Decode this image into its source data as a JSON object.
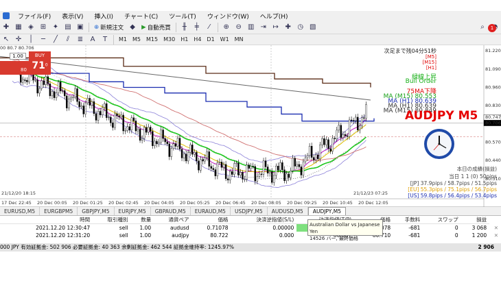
{
  "menu": {
    "items": [
      "ファイル(F)",
      "表示(V)",
      "挿入(I)",
      "チャート(C)",
      "ツール(T)",
      "ウィンドウ(W)",
      "ヘルプ(H)"
    ]
  },
  "toolbar": {
    "new_order": "新規注文",
    "auto_trading": "自動売買",
    "notifications": "1",
    "timeframes": [
      "M1",
      "M5",
      "M15",
      "M30",
      "H1",
      "H4",
      "D1",
      "W1",
      "MN"
    ]
  },
  "chart": {
    "header_text": "00 80.7 80.706",
    "oneclick": {
      "lot": "1.00",
      "buy_label": "BUY",
      "sell_prefix": "80",
      "sell_big": "71",
      "sell_sup": "0"
    },
    "countdown": "次足まで残04分51秒",
    "tf_m5": "[M5]",
    "tf_m15": "[M15]",
    "tf_h1": "[H1]",
    "trend_up": "緑線上昇",
    "bull_order": "Bull Order",
    "ma_down": "75MA下降",
    "ma_lines": [
      {
        "text": "MA (M15) 80.553",
        "color": "#19a019"
      },
      {
        "text": "MA (H1) 80.639",
        "color": "#1a2db0"
      },
      {
        "text": "MA (H1) 80.639",
        "color": "#333333"
      },
      {
        "text": "MA (M15) 80.849",
        "color": "#333333"
      }
    ],
    "symbol": "AUDJPY M5",
    "price_axis": [
      "81.220",
      "81.090",
      "80.960",
      "80.830",
      "80.747",
      "80.706",
      "80.570",
      "80.440",
      "80.310"
    ],
    "time_axis": [
      "17 Dec 22:45",
      "20 Dec 00:05",
      "20 Dec 01:25",
      "20 Dec 02:45",
      "20 Dec 04:05",
      "20 Dec 05:25",
      "20 Dec 06:45",
      "20 Dec 08:05",
      "20 Dec 09:25",
      "20 Dec 10:45",
      "20 Dec 12:05"
    ],
    "stat_lines": [
      {
        "text": "本日の成績(損益)",
        "color": "#444444"
      },
      {
        "text": "当日 1 1 (0) 50pips",
        "color": "#444444"
      },
      {
        "text": "[JP] 37.9pips / 58.7pips / 51.5pips",
        "color": "#444444"
      },
      {
        "text": "[EU] 55.3pips / 75.1pips / 56.7pips",
        "color": "#e0a000"
      },
      {
        "text": "[US] 59.8pips / 56.4pips / 53.4pips",
        "color": "#1a2db0"
      }
    ],
    "left_time": "21/12/20 18:15",
    "right_time": "21/12/23 07:25"
  },
  "tabs": [
    "EURUSD,M5",
    "EURGBPM5",
    "GBPJPY,M5",
    "EURJPY,M5",
    "GBPAUD,M5",
    "EURAUD,M5",
    "USDJPY,M5",
    "AUDUSD,M5",
    "AUDJPY,M5"
  ],
  "active_tab": 8,
  "terminal": {
    "headers": [
      "時間",
      "取引種別",
      "数量",
      "通貨ペア",
      "価格",
      "決済逆指値(S/L)",
      "決済指値(T/P)",
      "価格",
      "手数料",
      "スワップ",
      "損益"
    ],
    "rows": [
      [
        "2021.12.20 12:30:47",
        "sell",
        "1.00",
        "audusd",
        "0.71078",
        "0.00000",
        "0.70",
        "0.71078",
        "-681",
        "0",
        "3 068"
      ],
      [
        "2021.12.20 12:31:20",
        "sell",
        "1.00",
        "audjpy",
        "80.722",
        "0.000",
        "80.587",
        "80.710",
        "-681",
        "0",
        "1 200"
      ]
    ],
    "tooltip_title": "Australian Dollar vs Japanese Yen",
    "tooltip_text": "14526 バー, 最終価格 80.71200",
    "balance": "000 JPY 有効証拠金: 502 906 必要証拠金: 40 363 余剰証拠金: 462 544 証拠金維持率: 1245.97%",
    "total": "2 906"
  },
  "colors": {
    "bull": "#ffffff",
    "bear": "#000000",
    "ma_green": "#1ec81e",
    "ma_blue": "#1a2db0",
    "ma_brown": "#5a2b16",
    "bollinger": "#8a7fd8"
  }
}
